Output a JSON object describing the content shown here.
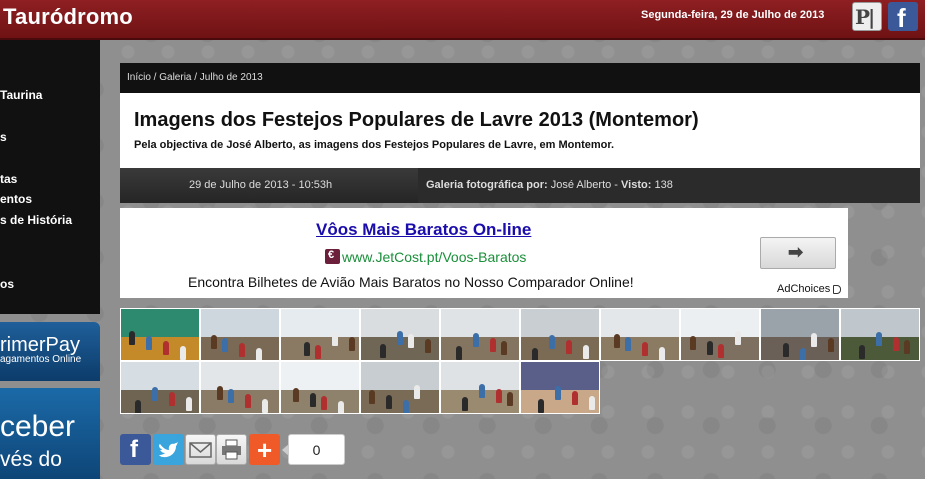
{
  "header": {
    "site_title": "Taurodromo",
    "site_title_display": "Tauródromo",
    "date": "Segunda-feira, 29 de Julho de 2013",
    "icons": [
      "portal-logo-icon",
      "facebook-icon"
    ]
  },
  "sidebar": {
    "items": [
      {
        "label": "Taurina"
      },
      {
        "label": "s"
      },
      {
        "label": "tas"
      },
      {
        "label": "entos"
      },
      {
        "label": "s de História"
      },
      {
        "label": "os"
      }
    ],
    "banners": [
      {
        "line1": "rimerPay",
        "line2": "agamentos Online"
      },
      {
        "line1": "ceber",
        "line2": "vés do"
      }
    ]
  },
  "breadcrumb": "Início / Galeria / Julho de 2013",
  "article": {
    "title": "Imagens dos Festejos Populares de Lavre 2013 (Montemor)",
    "subtitle": "Pela objectiva de José Alberto, as imagens dos Festejos Populares de Lavre, em Montemor."
  },
  "meta": {
    "date": "29 de Julho de 2013 - 10:53h",
    "gallery_label": "Galeria fotográfica por:",
    "author": "José Alberto",
    "views_label": "Visto:",
    "views": "138"
  },
  "ad": {
    "title": "Vôos Mais Baratos On-line",
    "url": "www.JetCost.pt/Voos-Baratos",
    "description": "Encontra Bilhetes de Avião Mais Baratos no Nosso Comparador Online!",
    "button_icon": "arrow-right-icon",
    "adchoices": "AdChoices"
  },
  "gallery": {
    "thumbnails": [
      {
        "name": "festival-poster-thumb",
        "top": "#2e8a6e",
        "bottom": "#c48a2a"
      },
      {
        "name": "crowd-street-thumb",
        "top": "#cfd7de",
        "bottom": "#7a6a55"
      },
      {
        "name": "street-bulls-thumb",
        "top": "#e6ebef",
        "bottom": "#8a7a64"
      },
      {
        "name": "bull-run-thumb",
        "top": "#d9dde0",
        "bottom": "#6f6656"
      },
      {
        "name": "street-crowd-thumb",
        "top": "#dfe3e6",
        "bottom": "#847560"
      },
      {
        "name": "bulls-street-thumb",
        "top": "#c9ced2",
        "bottom": "#7b6b55"
      },
      {
        "name": "bull-people-thumb",
        "top": "#e4e7e9",
        "bottom": "#8b7b63"
      },
      {
        "name": "houses-bull-thumb",
        "top": "#eceff1",
        "bottom": "#7d7060"
      },
      {
        "name": "fence-runner-thumb",
        "top": "#9aa3aa",
        "bottom": "#6a6058"
      },
      {
        "name": "horseman-thumb",
        "top": "#bfc6cc",
        "bottom": "#4d5a3a"
      },
      {
        "name": "wall-climbers-thumb",
        "top": "#d6dde3",
        "bottom": "#6f6451"
      },
      {
        "name": "people-wall-thumb",
        "top": "#e3e6e8",
        "bottom": "#8a7b66"
      },
      {
        "name": "street-view-thumb",
        "top": "#eef1f3",
        "bottom": "#8f826c"
      },
      {
        "name": "crowd-bull-thumb",
        "top": "#c8cdd1",
        "bottom": "#7a6b57"
      },
      {
        "name": "forcado-thumb",
        "top": "#dfe2e4",
        "bottom": "#9a8a6f"
      },
      {
        "name": "night-house-thumb",
        "top": "#5a5f8a",
        "bottom": "#c9a88a"
      }
    ]
  },
  "share": {
    "buttons": [
      "facebook-icon",
      "twitter-icon",
      "mail-icon",
      "print-icon",
      "plus-icon"
    ],
    "count": "0"
  },
  "colors": {
    "header_bg": "#7b1618",
    "ad_title": "#1a0dab",
    "ad_url": "#1a8f3a",
    "page_bg": "#8f8f8f"
  }
}
